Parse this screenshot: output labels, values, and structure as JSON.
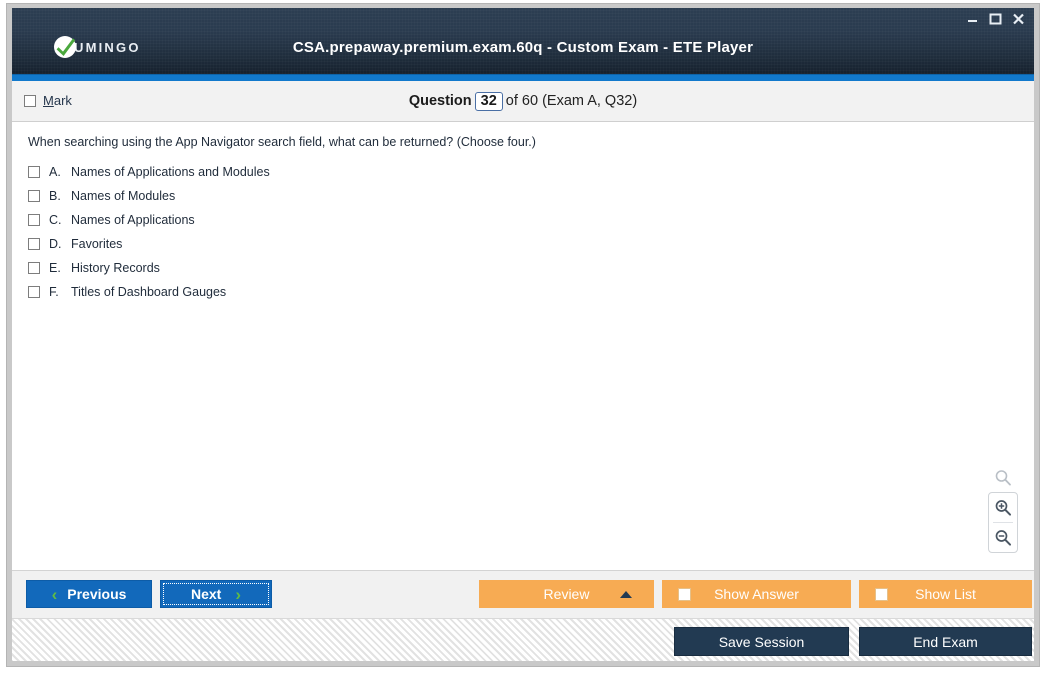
{
  "window": {
    "title": "CSA.prepaway.premium.exam.60q - Custom Exam - ETE Player",
    "logo_text": "UMINGO",
    "brand_full": "VUMINGO",
    "controls": {
      "minimize": "–",
      "maximize": "☐",
      "close": "✕"
    },
    "accent_blue": "#1279cc",
    "header_dark": "#22303f",
    "brand_green": "#4aa83d"
  },
  "question_bar": {
    "mark_label_accel": "M",
    "mark_label_rest": "ark",
    "prefix": "Question",
    "number": "32",
    "suffix": "of 60 (Exam A, Q32)"
  },
  "question": {
    "text": "When searching using the App Navigator search field, what can be returned? (Choose four.)",
    "options": [
      {
        "letter": "A.",
        "text": "Names of Applications and Modules",
        "checked": false
      },
      {
        "letter": "B.",
        "text": "Names of Modules",
        "checked": false
      },
      {
        "letter": "C.",
        "text": "Names of Applications",
        "checked": false
      },
      {
        "letter": "D.",
        "text": "Favorites",
        "checked": false
      },
      {
        "letter": "E.",
        "text": "History Records",
        "checked": false
      },
      {
        "letter": "F.",
        "text": "Titles of Dashboard Gauges",
        "checked": false
      }
    ]
  },
  "zoom_tools": {
    "search_icon": "search-icon",
    "zoom_in_icon": "zoom-in-icon",
    "zoom_out_icon": "zoom-out-icon"
  },
  "actions": {
    "previous": "Previous",
    "next": "Next",
    "review": "Review",
    "show_answer": "Show Answer",
    "show_list": "Show List",
    "orange": "#f7ab53",
    "blue": "#1269bb",
    "chevron_green": "#5fbb46"
  },
  "status": {
    "save_session": "Save Session",
    "end_exam": "End Exam"
  }
}
